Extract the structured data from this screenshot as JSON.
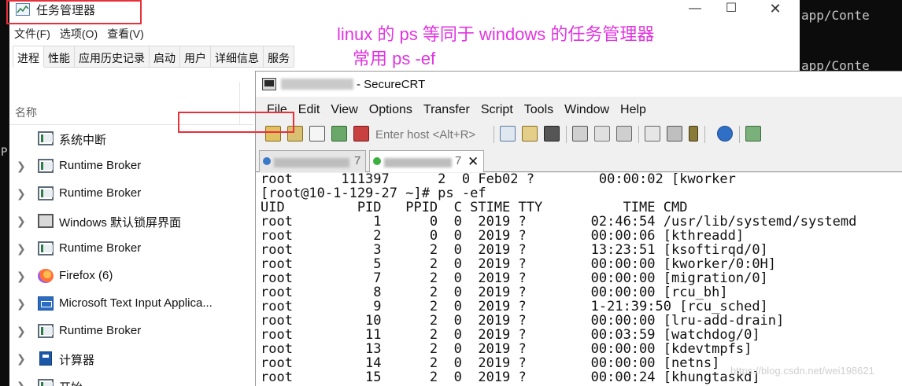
{
  "background": {
    "right_lines": [
      "app/Conte",
      "app/Conte"
    ],
    "left_glyph": "P"
  },
  "taskmgr": {
    "title": "任务管理器",
    "controls": {
      "minimize": "—",
      "maximize": "☐",
      "close": "✕"
    },
    "menu": [
      "文件(F)",
      "选项(O)",
      "查看(V)"
    ],
    "tabs": [
      "进程",
      "性能",
      "应用历史记录",
      "启动",
      "用户",
      "详细信息",
      "服务"
    ],
    "column_header": "名称",
    "processes": [
      {
        "name": "系统中断",
        "icon": "system-icon",
        "expandable": false
      },
      {
        "name": "Runtime Broker",
        "icon": "system-icon",
        "expandable": true
      },
      {
        "name": "Runtime Broker",
        "icon": "system-icon",
        "expandable": true
      },
      {
        "name": "Windows 默认锁屏界面",
        "icon": "lockscreen-icon",
        "expandable": true
      },
      {
        "name": "Runtime Broker",
        "icon": "system-icon",
        "expandable": true
      },
      {
        "name": "Firefox (6)",
        "icon": "firefox-icon",
        "expandable": true
      },
      {
        "name": "Microsoft Text Input Applica...",
        "icon": "text-input-icon",
        "expandable": true
      },
      {
        "name": "Runtime Broker",
        "icon": "system-icon",
        "expandable": true
      },
      {
        "name": "计算器",
        "icon": "calculator-icon",
        "expandable": true
      },
      {
        "name": "开始",
        "icon": "start-icon",
        "expandable": true
      }
    ]
  },
  "annotations": {
    "line1": "linux 的 ps  等同于 windows 的任务管理器",
    "line2": "常用    ps  -ef",
    "color": "#e135e1"
  },
  "securecrt": {
    "title": " - SecureCRT",
    "menu": [
      "File",
      "Edit",
      "View",
      "Options",
      "Transfer",
      "Script",
      "Tools",
      "Window",
      "Help"
    ],
    "host_placeholder": "Enter host <Alt+R>",
    "tabs": [
      {
        "label_suffix": "7",
        "active": false
      },
      {
        "label_suffix": "7",
        "active": true,
        "close": "✕"
      }
    ],
    "terminal_lines": [
      "root      111397      2  0 Feb02 ?        00:00:02 [kworker",
      "[root@10-1-129-27 ~]# ps -ef",
      "UID         PID   PPID  C STIME TTY          TIME CMD",
      "root          1      0  0  2019 ?        02:46:54 /usr/lib/systemd/systemd",
      "root          2      0  0  2019 ?        00:00:06 [kthreadd]",
      "root          3      2  0  2019 ?        13:23:51 [ksoftirqd/0]",
      "root          5      2  0  2019 ?        00:00:00 [kworker/0:0H]",
      "root          7      2  0  2019 ?        00:00:00 [migration/0]",
      "root          8      2  0  2019 ?        00:00:00 [rcu_bh]",
      "root          9      2  0  2019 ?        1-21:39:50 [rcu_sched]",
      "root         10      2  0  2019 ?        00:00:00 [lru-add-drain]",
      "root         11      2  0  2019 ?        00:03:59 [watchdog/0]",
      "root         13      2  0  2019 ?        00:00:00 [kdevtmpfs]",
      "root         14      2  0  2019 ?        00:00:00 [netns]",
      "root         15      2  0  2019 ?        00:00:24 [khungtaskd]"
    ]
  },
  "watermark": "https://blog.csdn.net/wei198621",
  "colors": {
    "highlight_box": "#e8303a",
    "annotation": "#e135e1"
  }
}
